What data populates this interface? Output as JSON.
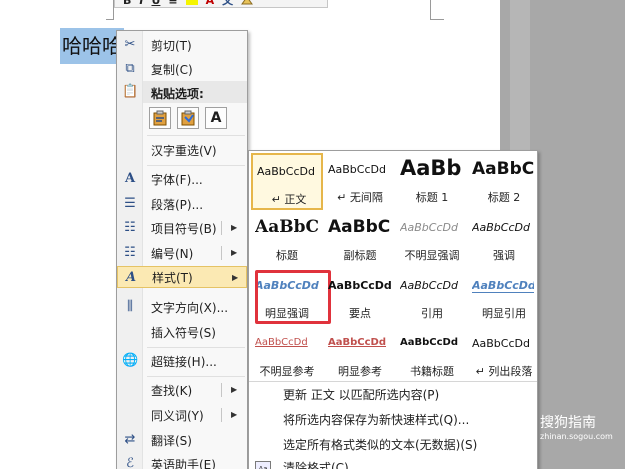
{
  "document": {
    "text": "哈哈哈"
  },
  "mini_toolbar": {
    "buttons": [
      "B",
      "I",
      "U",
      "≡",
      "A",
      "文"
    ]
  },
  "context_menu": {
    "cut": "剪切(T)",
    "copy": "复制(C)",
    "paste_header": "粘贴选项:",
    "paste_options": [
      "keep-format",
      "merge-format",
      "text-only"
    ],
    "paste_text_glyph": "A",
    "reconvert": "汉字重选(V)",
    "font": "字体(F)...",
    "paragraph": "段落(P)...",
    "bullets": "项目符号(B)",
    "numbering": "编号(N)",
    "styles": "样式(T)",
    "text_direction": "文字方向(X)...",
    "insert_symbol": "插入符号(S)",
    "hyperlink": "超链接(H)...",
    "lookup": "查找(K)",
    "synonyms": "同义词(Y)",
    "translate": "翻译(S)",
    "english_assistant": "英语助手(E)"
  },
  "styles_gallery": {
    "tiles": [
      {
        "sample": "AaBbCcDd",
        "name": "↵ 正文"
      },
      {
        "sample": "AaBbCcDd",
        "name": "↵ 无间隔"
      },
      {
        "sample": "AaBb",
        "name": "标题 1"
      },
      {
        "sample": "AaBbC",
        "name": "标题 2"
      },
      {
        "sample": "AaBbC",
        "name": "标题"
      },
      {
        "sample": "AaBbC",
        "name": "副标题"
      },
      {
        "sample": "AaBbCcDd",
        "name": "不明显强调"
      },
      {
        "sample": "AaBbCcDd",
        "name": "强调"
      },
      {
        "sample": "AaBbCcDd",
        "name": "明显强调"
      },
      {
        "sample": "AaBbCcDd",
        "name": "要点"
      },
      {
        "sample": "AaBbCcDd",
        "name": "引用"
      },
      {
        "sample": "AaBbCcDd",
        "name": "明显引用"
      },
      {
        "sample": "AaBbCcDd",
        "name": "不明显参考"
      },
      {
        "sample": "AaBbCcDd",
        "name": "明显参考"
      },
      {
        "sample": "AaBbCcDd",
        "name": "书籍标题"
      },
      {
        "sample": "AaBbCcDd",
        "name": "↵ 列出段落"
      }
    ],
    "commands": {
      "update": "更新 正文 以匹配所选内容(P)",
      "save_quick": "将所选内容保存为新快速样式(Q)...",
      "select_all": "选定所有格式类似的文本(无数据)(S)",
      "clear": "清除格式(C)"
    }
  },
  "watermark": {
    "name": "搜狗指南",
    "url": "zhinan.sogou.com"
  }
}
